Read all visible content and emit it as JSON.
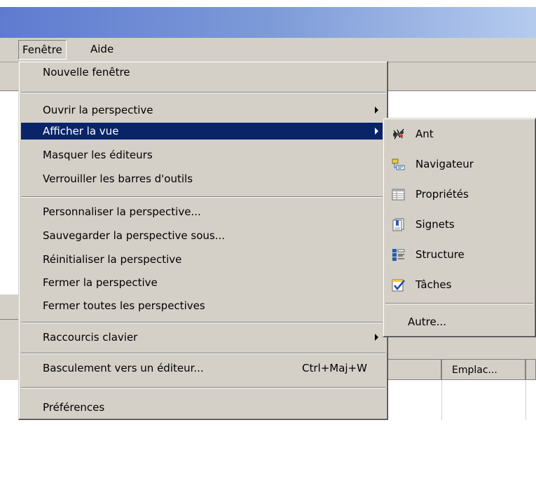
{
  "menubar": {
    "items": [
      {
        "label": "Fenêtre",
        "name": "menu-fenetre"
      },
      {
        "label": "Aide",
        "name": "menu-aide"
      }
    ]
  },
  "window_menu": {
    "items": [
      {
        "label": "Nouvelle fenêtre"
      },
      {
        "label": "Ouvrir la perspective",
        "submenu": true
      },
      {
        "label": "Afficher la vue",
        "submenu": true,
        "selected": true
      },
      {
        "label": "Masquer les éditeurs"
      },
      {
        "label": "Verrouiller les barres d'outils"
      },
      {
        "label": "Personnaliser la perspective..."
      },
      {
        "label": "Sauvegarder la perspective sous..."
      },
      {
        "label": "Réinitialiser la perspective"
      },
      {
        "label": "Fermer la perspective"
      },
      {
        "label": "Fermer toutes les perspectives"
      },
      {
        "label": "Raccourcis clavier",
        "submenu": true
      },
      {
        "label": "Basculement vers un éditeur...",
        "accelerator": "Ctrl+Maj+W"
      },
      {
        "label": "Préférences"
      }
    ]
  },
  "show_view_submenu": {
    "items": [
      {
        "label": "Ant",
        "icon": "ant-icon"
      },
      {
        "label": "Navigateur",
        "icon": "navigator-icon"
      },
      {
        "label": "Propriétés",
        "icon": "properties-icon"
      },
      {
        "label": "Signets",
        "icon": "bookmarks-icon"
      },
      {
        "label": "Structure",
        "icon": "outline-icon"
      },
      {
        "label": "Tâches",
        "icon": "tasks-icon"
      },
      {
        "label": "Autre..."
      }
    ]
  },
  "background": {
    "table_header": "Emplac..."
  },
  "colors": {
    "menu_face": "#d4d0c8",
    "selection": "#0a246a",
    "title_gradient_start": "#5e7bd0",
    "title_gradient_end": "#b5cbee"
  }
}
